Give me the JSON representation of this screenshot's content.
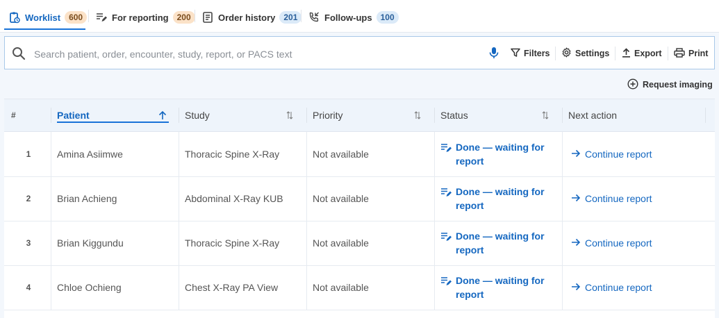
{
  "tabs": [
    {
      "label": "Worklist",
      "count": "600"
    },
    {
      "label": "For reporting",
      "count": "200"
    },
    {
      "label": "Order history",
      "count": "201"
    },
    {
      "label": "Follow-ups",
      "count": "100"
    }
  ],
  "search": {
    "placeholder": "Search patient, order, encounter, study, report, or PACS text",
    "value": ""
  },
  "toolbar": {
    "filters": "Filters",
    "settings": "Settings",
    "export": "Export",
    "print": "Print"
  },
  "request_imaging": "Request imaging",
  "table": {
    "columns": [
      "#",
      "Patient",
      "Study",
      "Priority",
      "Status",
      "Next action"
    ],
    "rows": [
      {
        "num": "1",
        "patient": "Amina Asiimwe",
        "study": "Thoracic Spine X-Ray",
        "priority": "Not available",
        "status_line1": "Done — waiting for",
        "status_line2": "report",
        "action": "Continue report"
      },
      {
        "num": "2",
        "patient": "Brian Achieng",
        "study": "Abdominal X-Ray KUB",
        "priority": "Not available",
        "status_line1": "Done — waiting for",
        "status_line2": "report",
        "action": "Continue report"
      },
      {
        "num": "3",
        "patient": "Brian Kiggundu",
        "study": "Thoracic Spine X-Ray",
        "priority": "Not available",
        "status_line1": "Done — waiting for",
        "status_line2": "report",
        "action": "Continue report"
      },
      {
        "num": "4",
        "patient": "Chloe Ochieng",
        "study": "Chest X-Ray PA View",
        "priority": "Not available",
        "status_line1": "Done — waiting for",
        "status_line2": "report",
        "action": "Continue report"
      }
    ]
  },
  "colors": {
    "accent": "#1467c0",
    "badge_orange": "#fbe2c8",
    "badge_blue": "#dbeaf8"
  }
}
